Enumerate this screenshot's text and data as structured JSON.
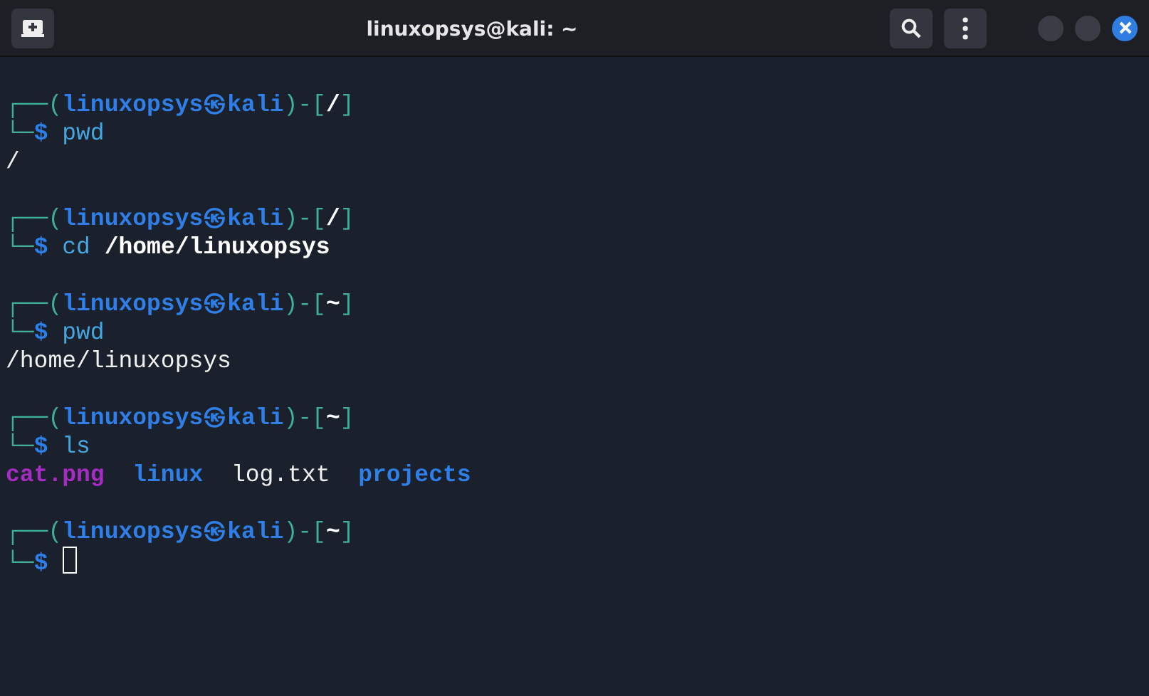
{
  "window": {
    "title": "linuxopsys@kali: ~",
    "cursor_visible": true
  },
  "blocks": [
    {
      "prompt": {
        "frame_top": "┌──(",
        "user": "linuxopsys",
        "at": "㉿",
        "host": "kali",
        "sep": ")-[",
        "dir": "/",
        "close": "]",
        "frame_bottom": "└─",
        "dollar": "$"
      },
      "command": [
        {
          "text": "pwd",
          "kind": "program"
        }
      ],
      "output": [
        {
          "text": "/",
          "kind": "plain"
        }
      ]
    },
    {
      "prompt": {
        "frame_top": "┌──(",
        "user": "linuxopsys",
        "at": "㉿",
        "host": "kali",
        "sep": ")-[",
        "dir": "/",
        "close": "]",
        "frame_bottom": "└─",
        "dollar": "$"
      },
      "command": [
        {
          "text": "cd",
          "kind": "program"
        },
        {
          "text": "/home/linuxopsys",
          "kind": "argument"
        }
      ]
    },
    {
      "prompt": {
        "frame_top": "┌──(",
        "user": "linuxopsys",
        "at": "㉿",
        "host": "kali",
        "sep": ")-[",
        "dir": "~",
        "close": "]",
        "frame_bottom": "└─",
        "dollar": "$"
      },
      "command": [
        {
          "text": "pwd",
          "kind": "program"
        }
      ],
      "output": [
        {
          "text": "/home/linuxopsys",
          "kind": "plain"
        }
      ]
    },
    {
      "prompt": {
        "frame_top": "┌──(",
        "user": "linuxopsys",
        "at": "㉿",
        "host": "kali",
        "sep": ")-[",
        "dir": "~",
        "close": "]",
        "frame_bottom": "└─",
        "dollar": "$"
      },
      "command": [
        {
          "text": "ls",
          "kind": "program"
        }
      ],
      "output": [
        {
          "text": "cat.png",
          "kind": "image"
        },
        {
          "text": "linux",
          "kind": "directory"
        },
        {
          "text": "log.txt",
          "kind": "plain"
        },
        {
          "text": "projects",
          "kind": "directory"
        }
      ]
    },
    {
      "prompt": {
        "frame_top": "┌──(",
        "user": "linuxopsys",
        "at": "㉿",
        "host": "kali",
        "sep": ")-[",
        "dir": "~",
        "close": "]",
        "frame_bottom": "└─",
        "dollar": "$"
      }
    }
  ]
}
